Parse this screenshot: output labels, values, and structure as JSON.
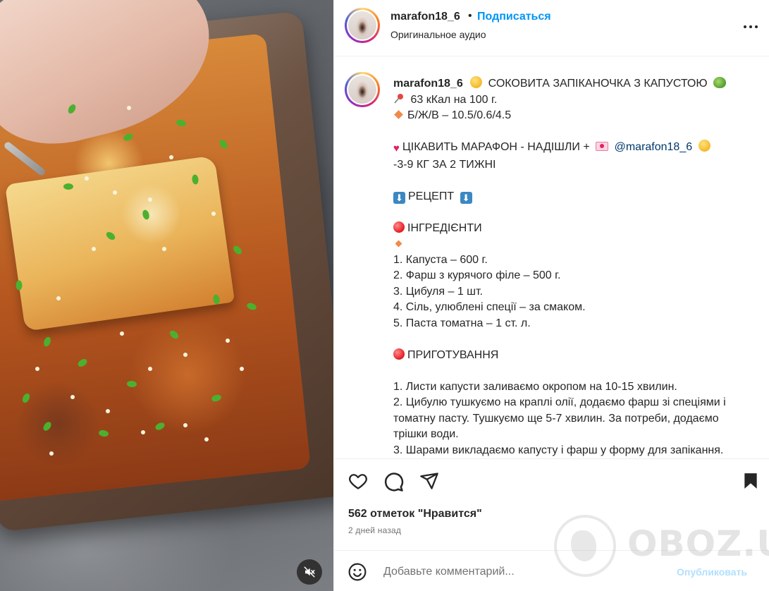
{
  "post": {
    "username": "marafon18_6",
    "separator": "•",
    "follow_label": "Подписаться",
    "audio_label": "Оригинальное аудио",
    "more_label": "Ещё"
  },
  "caption": {
    "username": "marafon18_6",
    "title": "СОКОВИТА ЗАПІКАНОЧКА З КАПУСТОЮ",
    "calories": "63 кКал на 100 г.",
    "macros": "Б/Ж/В – 10.5/0.6/4.5",
    "marathon_text": "ЦІКАВИТЬ МАРАФОН - НАДІШЛИ +",
    "mention": "@marafon18_6",
    "result": "-3-9 КГ ЗА 2 ТИЖНІ",
    "recipe_heading": "РЕЦЕПТ",
    "ingredients_heading": "ІНГРЕДІЄНТИ",
    "ingredients": [
      "1. Капуста – 600 г.",
      "2. Фарш з курячого філе – 500 г.",
      "3. Цибуля – 1 шт.",
      "4. Сіль, улюблені спеції – за смаком.",
      "5. Паста томатна – 1 ст. л."
    ],
    "preparation_heading": "ПРИГОТУВАННЯ",
    "steps": [
      "1. Листи капусти заливаємо окропом на 10-15 хвилин.",
      "2. Цибулю тушкуємо на краплі олії, додаємо фарш зі спеціями і томатну пасту. Тушкуємо ще 5-7 хвилин. За потреби, додаємо трішки води.",
      "3. Шарами викладаємо капусту і фарш у форму для запікання."
    ]
  },
  "stats": {
    "likes": "562 отметок \"Нравится\"",
    "time_ago": "2 дней назад"
  },
  "comment": {
    "placeholder": "Добавьте комментарий...",
    "post_label": "Опубликовать"
  },
  "watermark": {
    "text": "OBOZ.UA"
  },
  "icons": {
    "like": "heart-icon",
    "comment": "comment-bubble-icon",
    "share": "paper-plane-icon",
    "save": "bookmark-icon",
    "emoji": "smiley-icon",
    "mute": "speaker-muted-icon",
    "more": "more-dots-icon"
  },
  "colors": {
    "link": "#0095f6",
    "mention": "#00376b",
    "text": "#262626",
    "secondary": "#737373",
    "post_disabled": "#b2dffc"
  }
}
